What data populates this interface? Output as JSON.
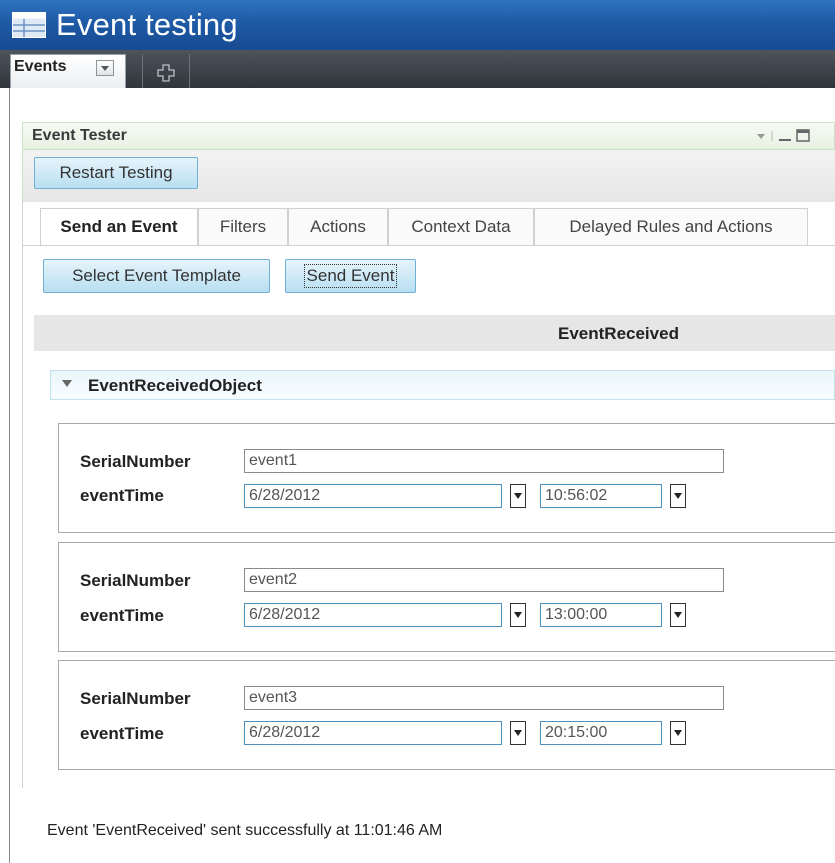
{
  "window": {
    "title": "Event testing"
  },
  "tabstrip": {
    "active_tab": "Events"
  },
  "panel": {
    "title": "Event Tester",
    "restart_label": "Restart Testing",
    "tabs": [
      "Send an Event",
      "Filters",
      "Actions",
      "Context Data",
      "Delayed Rules and Actions"
    ],
    "active_tab_index": 0,
    "select_template_label": "Select Event Template",
    "send_event_label": "Send Event"
  },
  "event": {
    "type": "EventReceived",
    "object_label": "EventReceivedObject",
    "field_labels": {
      "serial": "SerialNumber",
      "time": "eventTime"
    },
    "records": [
      {
        "serial": "event1",
        "date": "6/28/2012",
        "time": "10:56:02"
      },
      {
        "serial": "event2",
        "date": "6/28/2012",
        "time": "13:00:00"
      },
      {
        "serial": "event3",
        "date": "6/28/2012",
        "time": "20:15:00"
      }
    ]
  },
  "status": "Event 'EventReceived' sent successfully at 11:01:46 AM",
  "colors": {
    "title_bar": "#1e5aa5",
    "button": "#b8dff1",
    "button_border": "#6fb0d4"
  },
  "icons": {
    "app": "app-window-icon",
    "tab_dropdown": "chevron-down-icon",
    "add_tab": "plus-icon",
    "panel_controls": [
      "menu-icon",
      "minimize-icon",
      "maximize-icon"
    ]
  }
}
